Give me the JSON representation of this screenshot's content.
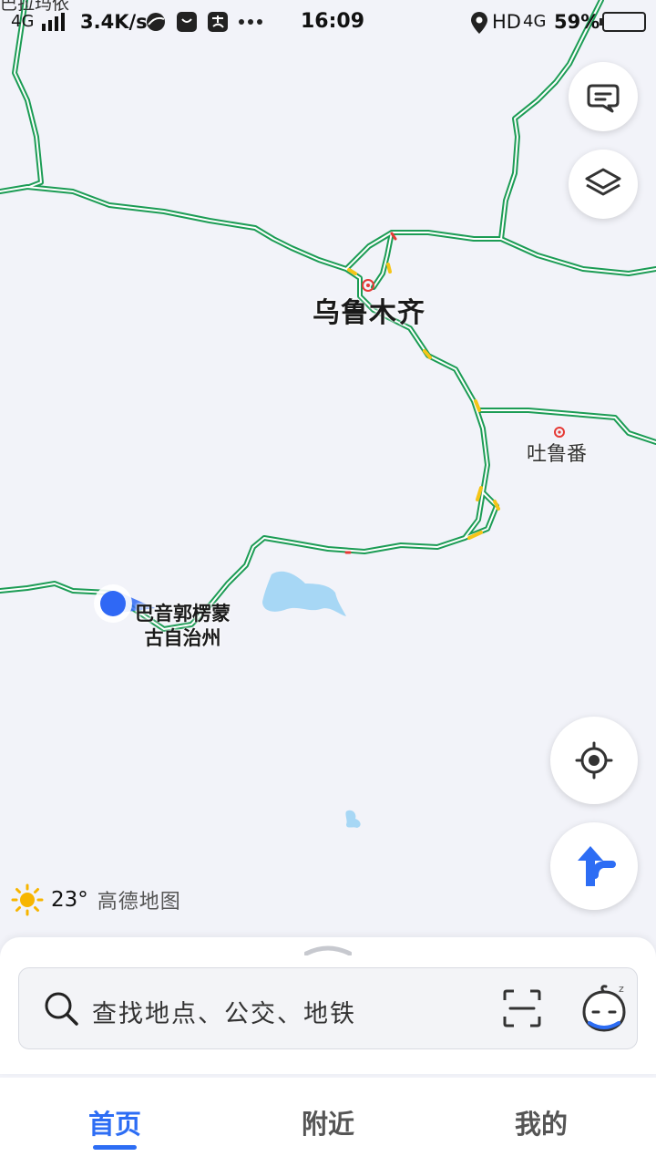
{
  "status_bar": {
    "carrier_overlay": "巴拉玛依",
    "network": "4G",
    "speed": "3.4K/s",
    "time": "16:09",
    "hd": "HD",
    "network2": "4G",
    "battery": "59%"
  },
  "map": {
    "city_main": "乌鲁木齐",
    "city_secondary": "吐鲁番",
    "region_line1": "巴音郭楞蒙",
    "region_line2": "古自治州",
    "road_color": "#27b86a",
    "water_color": "#a7d7f5",
    "location_color": "#2f68f5"
  },
  "weather": {
    "icon": "sun-icon",
    "temperature": "23°",
    "brand": "高德地图"
  },
  "search": {
    "placeholder": "查找地点、公交、地铁"
  },
  "tabs": [
    {
      "label": "首页",
      "active": true
    },
    {
      "label": "附近",
      "active": false
    },
    {
      "label": "我的",
      "active": false
    }
  ],
  "accent": "#2d6df4"
}
